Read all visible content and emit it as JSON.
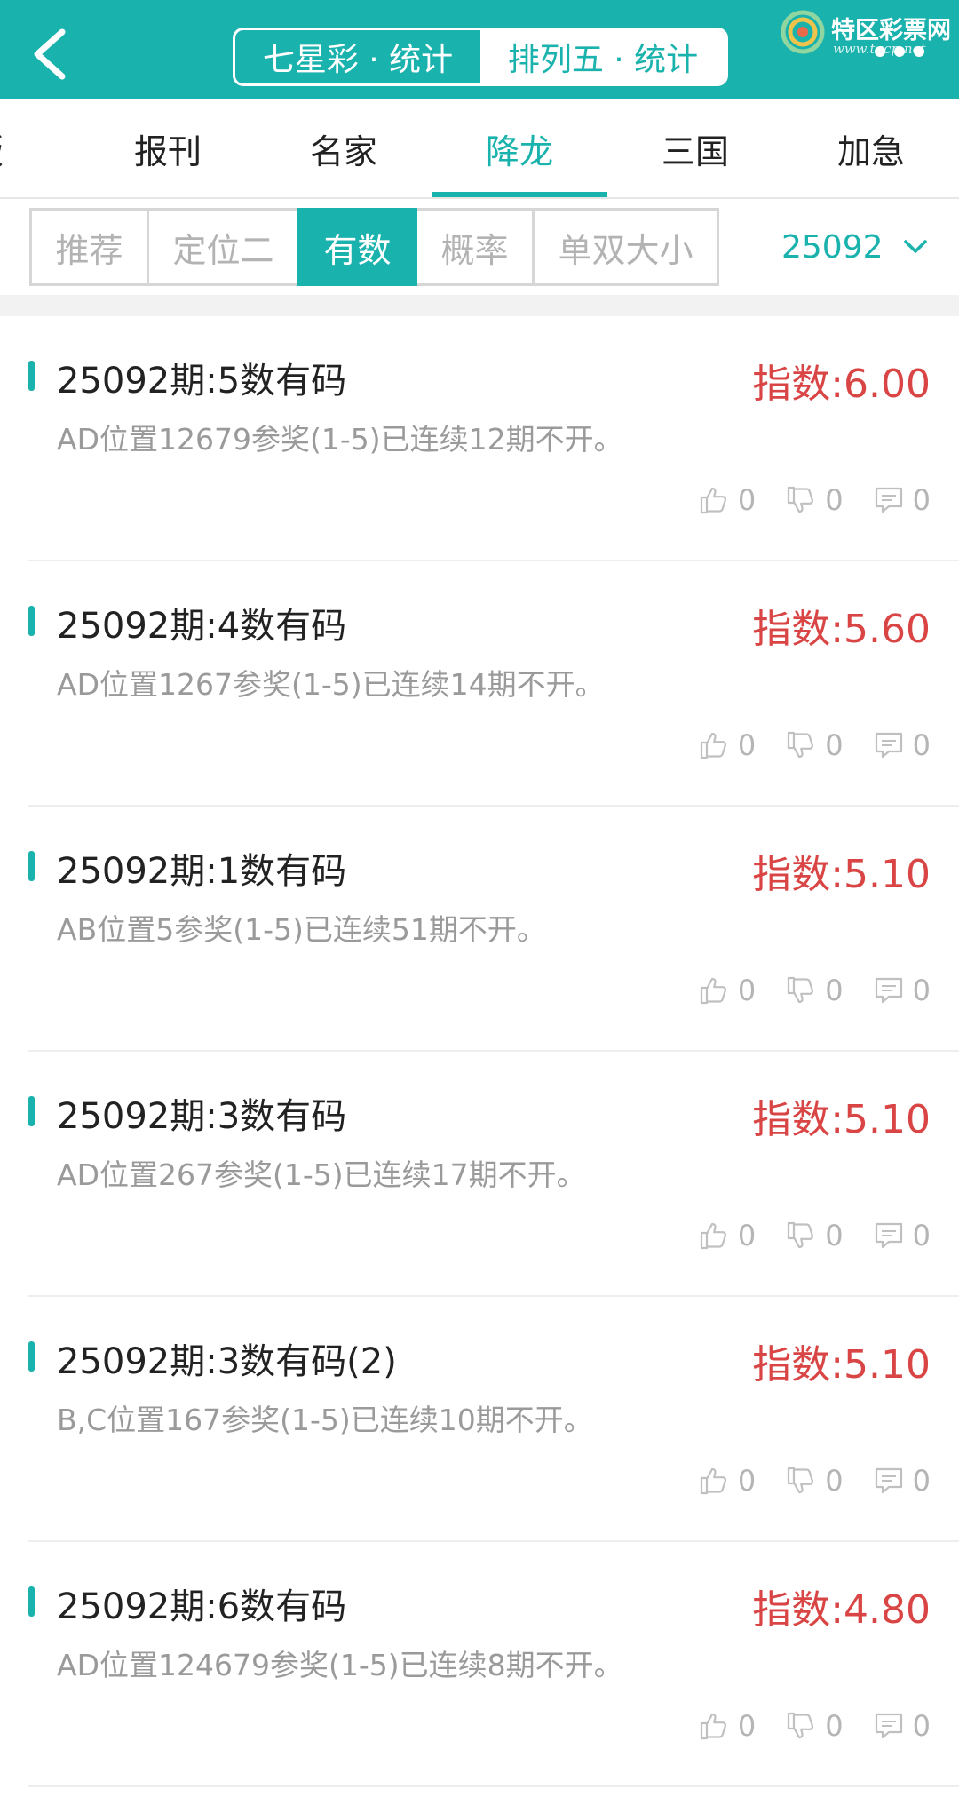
{
  "header": {
    "segments": [
      "七星彩 · 统计",
      "排列五 · 统计"
    ],
    "active_segment": 1,
    "logo_text": "特区彩票网",
    "logo_sub": "www.tqcp.net"
  },
  "category_tabs": [
    "版",
    "报刊",
    "名家",
    "降龙",
    "三国",
    "加急"
  ],
  "active_category": "降龙",
  "sub_tabs": [
    "推荐",
    "定位二",
    "有数",
    "概率",
    "单双大小"
  ],
  "active_sub_tab": "有数",
  "period_select": {
    "value": "25092"
  },
  "cards": [
    {
      "title": "25092期:5数有码",
      "index": "指数:6.00",
      "desc": "AD位置12679参奖(1-5)已连续12期不开。",
      "likes": "0",
      "dislikes": "0",
      "comments": "0"
    },
    {
      "title": "25092期:4数有码",
      "index": "指数:5.60",
      "desc": "AD位置1267参奖(1-5)已连续14期不开。",
      "likes": "0",
      "dislikes": "0",
      "comments": "0"
    },
    {
      "title": "25092期:1数有码",
      "index": "指数:5.10",
      "desc": "AB位置5参奖(1-5)已连续51期不开。",
      "likes": "0",
      "dislikes": "0",
      "comments": "0"
    },
    {
      "title": "25092期:3数有码",
      "index": "指数:5.10",
      "desc": "AD位置267参奖(1-5)已连续17期不开。",
      "likes": "0",
      "dislikes": "0",
      "comments": "0"
    },
    {
      "title": "25092期:3数有码(2)",
      "index": "指数:5.10",
      "desc": "B,C位置167参奖(1-5)已连续10期不开。",
      "likes": "0",
      "dislikes": "0",
      "comments": "0"
    },
    {
      "title": "25092期:6数有码",
      "index": "指数:4.80",
      "desc": "AD位置124679参奖(1-5)已连续8期不开。",
      "likes": "0",
      "dislikes": "0",
      "comments": "0"
    }
  ],
  "colors": {
    "accent": "#1ab2ad",
    "index_red": "#d94545"
  },
  "icons": [
    "back-icon",
    "more-icon",
    "chevron-down-icon",
    "thumbs-up-icon",
    "thumbs-down-icon",
    "comment-icon"
  ]
}
